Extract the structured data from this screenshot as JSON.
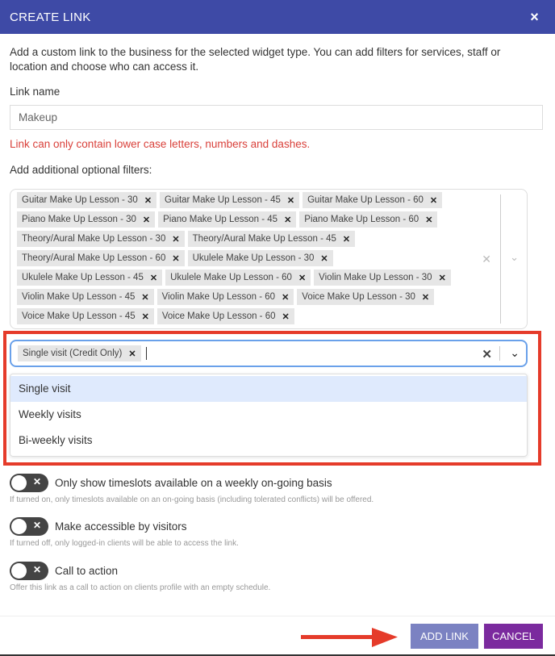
{
  "dialog": {
    "title": "CREATE LINK",
    "close_icon": "×",
    "description": "Add a custom link to the business for the selected widget type. You can add filters for services, staff or location and choose who can access it.",
    "link_name_label": "Link name",
    "link_name_value": "Makeup",
    "error": "Link can only contain lower case letters, numbers and dashes.",
    "filters_label": "Add additional optional filters:"
  },
  "services": {
    "rows": [
      [
        "Guitar Make Up Lesson - 30",
        "Guitar Make Up Lesson - 45",
        "Guitar Make Up Lesson - 60"
      ],
      [
        "Piano Make Up Lesson - 30",
        "Piano Make Up Lesson - 45",
        "Piano Make Up Lesson - 60"
      ],
      [
        "Theory/Aural Make Up Lesson - 30",
        "Theory/Aural Make Up Lesson - 45"
      ],
      [
        "Theory/Aural Make Up Lesson - 60",
        "Ukulele Make Up Lesson - 30"
      ],
      [
        "Ukulele Make Up Lesson - 45",
        "Ukulele Make Up Lesson - 60",
        "Violin Make Up Lesson - 30"
      ],
      [
        "Violin Make Up Lesson - 45",
        "Violin Make Up Lesson - 60",
        "Voice Make Up Lesson - 30"
      ],
      [
        "Voice Make Up Lesson - 45",
        "Voice Make Up Lesson - 60"
      ]
    ]
  },
  "visit_select": {
    "selected": "Single visit (Credit Only)",
    "options": [
      "Single visit",
      "Weekly visits",
      "Bi-weekly visits"
    ],
    "highlighted": 0
  },
  "toggles": [
    {
      "label": "Only show timeslots available on a weekly on-going basis",
      "hint": "If turned on, only timeslots available on an on-going basis (including tolerated conflicts) will be offered.",
      "on": false
    },
    {
      "label": "Make accessible by visitors",
      "hint": "If turned off, only logged-in clients will be able to access the link.",
      "on": false
    },
    {
      "label": "Call to action",
      "hint": "Offer this link as a call to action on clients profile with an empty schedule.",
      "on": false
    }
  ],
  "footer": {
    "add_label": "ADD LINK",
    "cancel_label": "CANCEL"
  },
  "colors": {
    "header": "#3e4aa6",
    "add": "#7b82c2",
    "cancel": "#7b2a9e",
    "highlight": "#e53b2a"
  }
}
